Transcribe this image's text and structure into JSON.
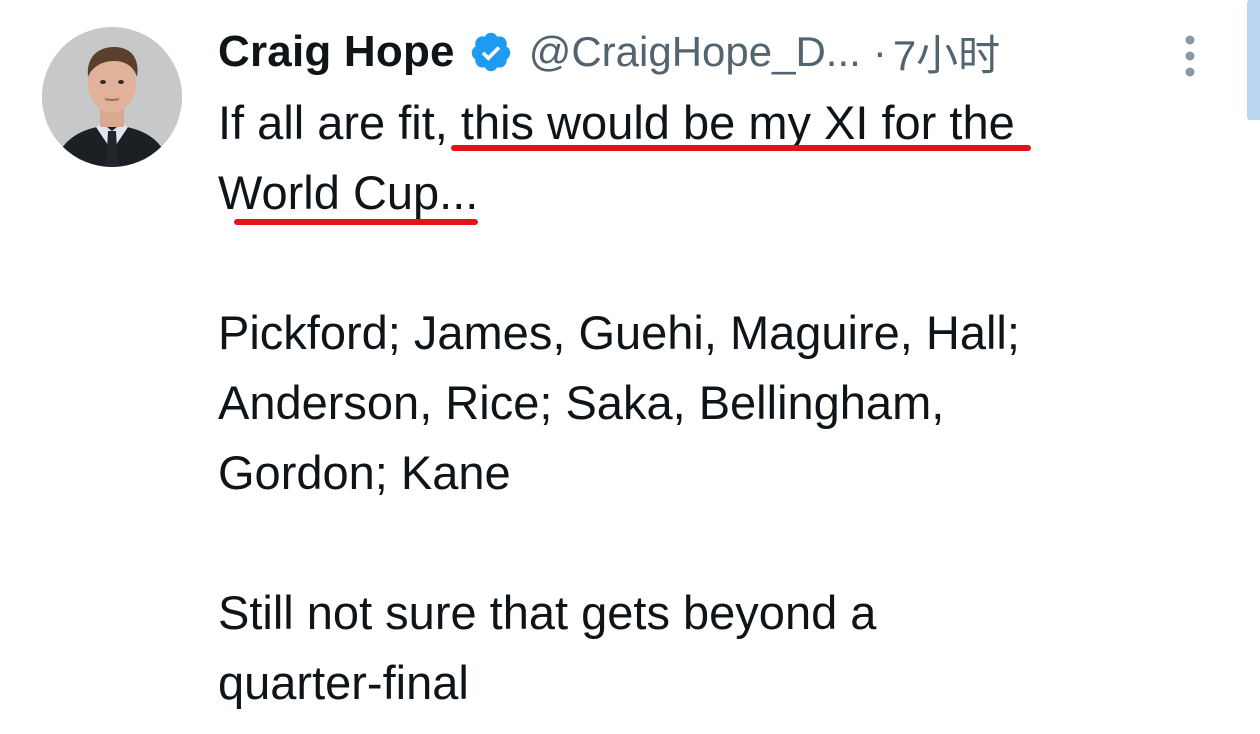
{
  "tweet": {
    "author": {
      "display_name": "Craig Hope",
      "handle": "@CraigHope_D...",
      "verified": true
    },
    "separator": "·",
    "timestamp": "7小时",
    "text": {
      "line1_plain": "If all are fit,",
      "line1_marked": "this would be my XI for the",
      "line2_marked": "World Cup...",
      "lineup_1": "Pickford; James, Guehi, Maguire, Hall;",
      "lineup_2": "Anderson, Rice; Saka, Bellingham,",
      "lineup_3": "Gordon; Kane",
      "closing_1": "Still not sure that gets beyond a",
      "closing_2": "quarter-final"
    },
    "more_icon": "more-vertical-icon",
    "verified_icon": "verified-badge-icon"
  },
  "colors": {
    "verified_blue": "#1d9bf0",
    "secondary_text": "#536471",
    "annotation_red": "#e4121a",
    "primary_text": "#0f1419"
  }
}
